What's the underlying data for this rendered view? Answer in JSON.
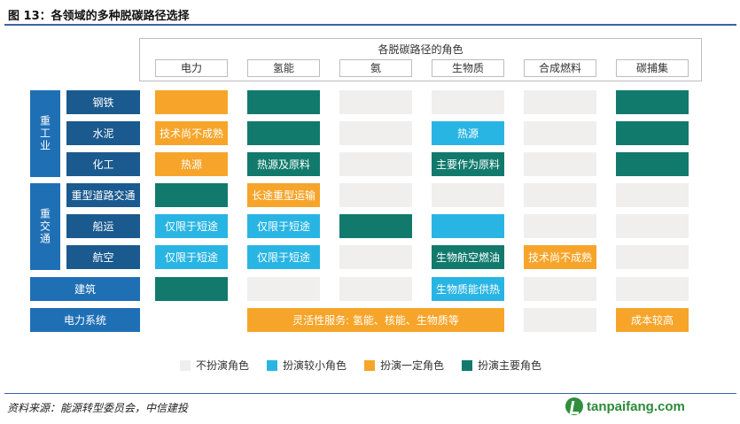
{
  "title": "图 13：各领域的多种脱碳路径选择",
  "roles_header": "各脱碳路径的角色",
  "columns": [
    "电力",
    "氢能",
    "氨",
    "生物质",
    "合成燃料",
    "碳捕集"
  ],
  "groups": [
    {
      "label": "重工业"
    },
    {
      "label": "重交通"
    }
  ],
  "rows": [
    {
      "label": "钢铁",
      "cells": [
        {
          "role": "certain",
          "text": ""
        },
        {
          "role": "major",
          "text": ""
        },
        {
          "role": "none",
          "text": ""
        },
        {
          "role": "none",
          "text": ""
        },
        {
          "role": "none",
          "text": ""
        },
        {
          "role": "major",
          "text": ""
        }
      ]
    },
    {
      "label": "水泥",
      "cells": [
        {
          "role": "certain",
          "text": "技术尚不成熟"
        },
        {
          "role": "major",
          "text": ""
        },
        {
          "role": "none",
          "text": ""
        },
        {
          "role": "minor",
          "text": "热源"
        },
        {
          "role": "none",
          "text": ""
        },
        {
          "role": "major",
          "text": ""
        }
      ]
    },
    {
      "label": "化工",
      "cells": [
        {
          "role": "certain",
          "text": "热源"
        },
        {
          "role": "major",
          "text": "热源及原料"
        },
        {
          "role": "none",
          "text": ""
        },
        {
          "role": "major",
          "text": "主要作为原料"
        },
        {
          "role": "none",
          "text": ""
        },
        {
          "role": "major",
          "text": ""
        }
      ]
    },
    {
      "label": "重型道路交通",
      "cells": [
        {
          "role": "major",
          "text": ""
        },
        {
          "role": "certain",
          "text": "长途重型运输"
        },
        {
          "role": "none",
          "text": ""
        },
        {
          "role": "none",
          "text": ""
        },
        {
          "role": "none",
          "text": ""
        },
        {
          "role": "none",
          "text": ""
        }
      ]
    },
    {
      "label": "船运",
      "cells": [
        {
          "role": "minor",
          "text": "仅限于短途"
        },
        {
          "role": "minor",
          "text": "仅限于短途"
        },
        {
          "role": "major",
          "text": ""
        },
        {
          "role": "minor",
          "text": ""
        },
        {
          "role": "none",
          "text": ""
        },
        {
          "role": "none",
          "text": ""
        }
      ]
    },
    {
      "label": "航空",
      "cells": [
        {
          "role": "minor",
          "text": "仅限于短途"
        },
        {
          "role": "minor",
          "text": "仅限于短途"
        },
        {
          "role": "none",
          "text": ""
        },
        {
          "role": "major",
          "text": "生物航空燃油"
        },
        {
          "role": "certain",
          "text": "技术尚不成熟"
        },
        {
          "role": "none",
          "text": ""
        }
      ]
    },
    {
      "label": "建筑",
      "cells": [
        {
          "role": "major",
          "text": ""
        },
        {
          "role": "none",
          "text": ""
        },
        {
          "role": "none",
          "text": ""
        },
        {
          "role": "minor",
          "text": "生物质能供热"
        },
        {
          "role": "none",
          "text": ""
        },
        {
          "role": "none",
          "text": ""
        }
      ]
    },
    {
      "label": "电力系统",
      "cells": [
        {
          "role": "certain",
          "text": "灵活性服务: 氢能、核能、生物质等"
        },
        {
          "role": "none",
          "text": ""
        },
        {
          "role": "certain",
          "text": "成本较高"
        }
      ]
    }
  ],
  "legend": [
    {
      "label": "不扮演角色",
      "color": "#f0efee"
    },
    {
      "label": "扮演较小角色",
      "color": "#29b5e3"
    },
    {
      "label": "扮演一定角色",
      "color": "#f6a52a"
    },
    {
      "label": "扮演主要角色",
      "color": "#117a6d"
    }
  ],
  "source": "资料来源：能源转型委员会，中信建投",
  "logo_text": "tanpaifang.com"
}
